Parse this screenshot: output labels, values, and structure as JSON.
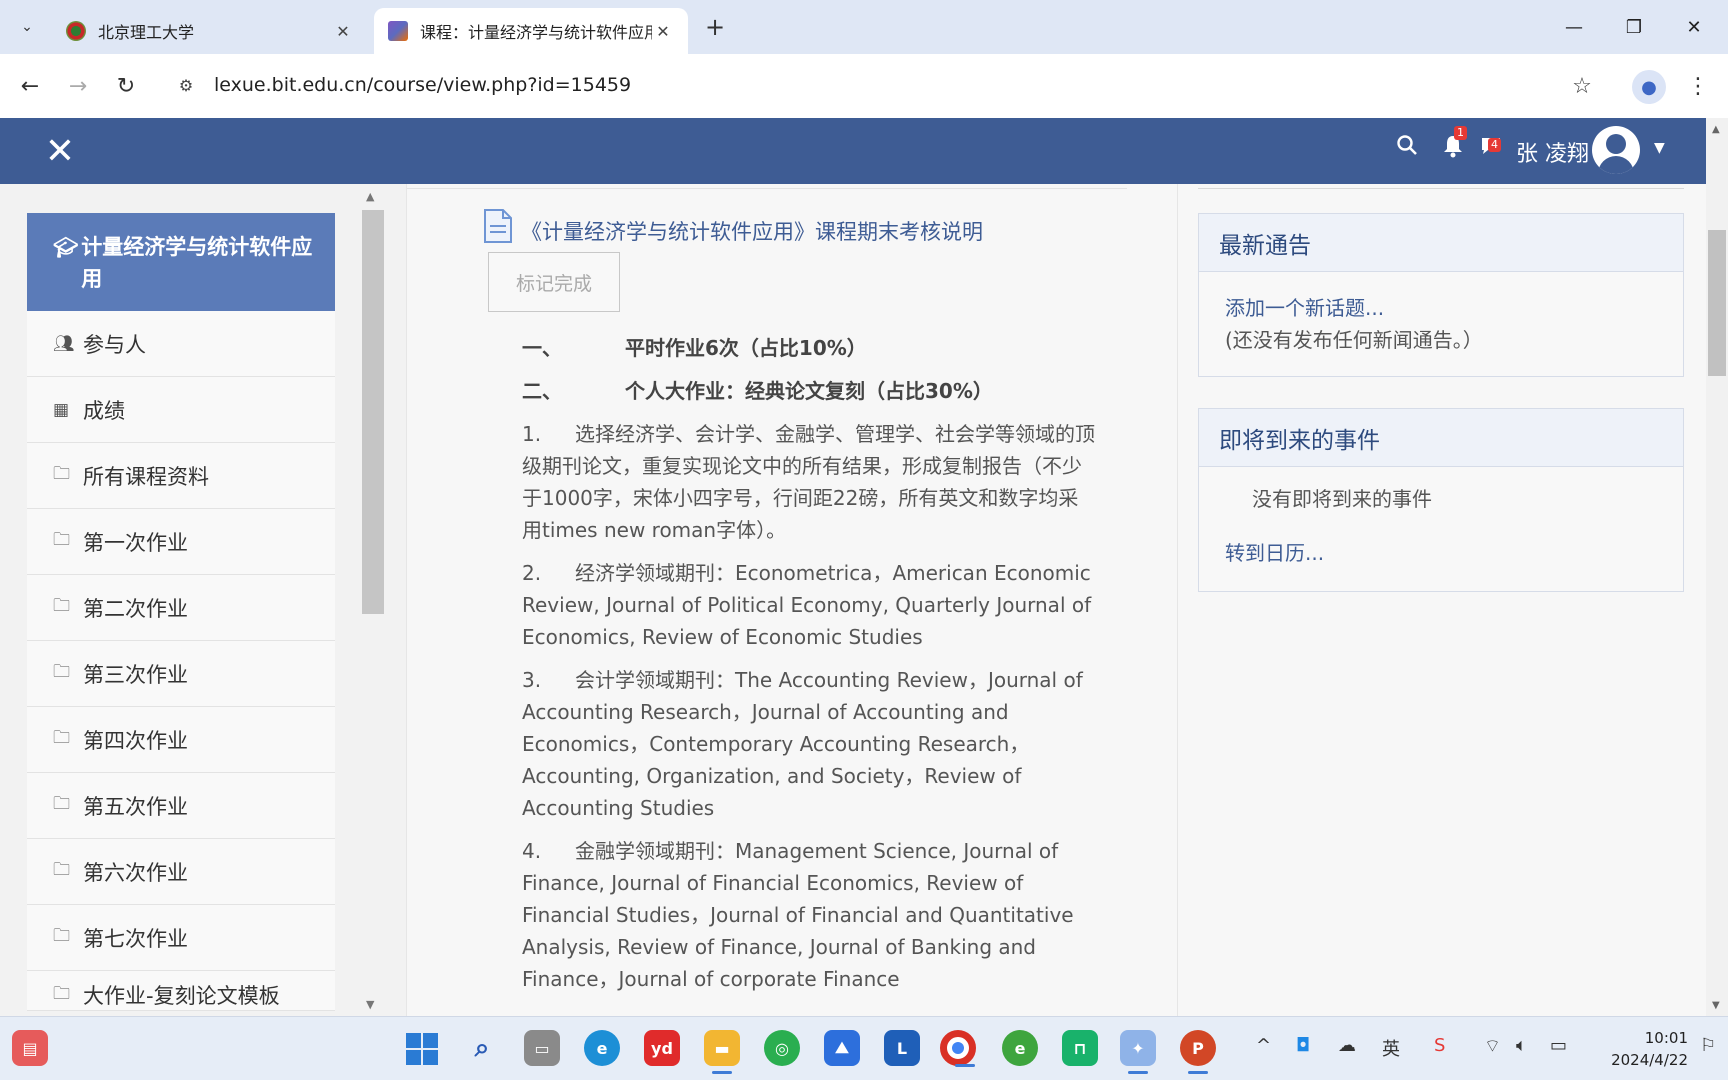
{
  "browser": {
    "tabs": [
      {
        "title": "北京理工大学"
      },
      {
        "title": "课程：计量经济学与统计软件应用"
      }
    ],
    "url": "lexue.bit.edu.cn/course/view.php?id=15459"
  },
  "header": {
    "notification_count": "1",
    "message_count": "4",
    "user_name": "张 凌翔"
  },
  "drawer": {
    "course_name": "计量经济学与统计软件应用",
    "items": [
      {
        "label": "参与人",
        "icon": "users-icon"
      },
      {
        "label": "成绩",
        "icon": "table-icon"
      },
      {
        "label": "所有课程资料",
        "icon": "folder-icon"
      },
      {
        "label": "第一次作业",
        "icon": "folder-icon"
      },
      {
        "label": "第二次作业",
        "icon": "folder-icon"
      },
      {
        "label": "第三次作业",
        "icon": "folder-icon"
      },
      {
        "label": "第四次作业",
        "icon": "folder-icon"
      },
      {
        "label": "第五次作业",
        "icon": "folder-icon"
      },
      {
        "label": "第六次作业",
        "icon": "folder-icon"
      },
      {
        "label": "第七次作业",
        "icon": "folder-icon"
      },
      {
        "label": "大作业-复刻论文模板",
        "icon": "folder-icon"
      }
    ]
  },
  "main": {
    "doc_title": "《计量经济学与统计软件应用》课程期末考核说明",
    "mark_done": "标记完成",
    "headings": [
      {
        "num": "一、",
        "text": "平时作业6次（占比10%）"
      },
      {
        "num": "二、",
        "text": "个人大作业：经典论文复刻（占比30%）"
      }
    ],
    "paragraphs": [
      {
        "num": "1.",
        "text": "选择经济学、会计学、金融学、管理学、社会学等领域的顶级期刊论文，重复实现论文中的所有结果，形成复制报告（不少于1000字，宋体小四字号，行间距22磅，所有英文和数字均采用times new roman字体）。"
      },
      {
        "num": "2.",
        "text": "经济学领域期刊：Econometrica，American Economic Review, Journal of Political Economy, Quarterly Journal of Economics, Review of Economic Studies"
      },
      {
        "num": "3.",
        "text": "会计学领域期刊：The Accounting Review，Journal of Accounting Research，Journal of Accounting and Economics，Contemporary Accounting Research，Accounting, Organization, and Society，Review of Accounting Studies"
      },
      {
        "num": "4.",
        "text": "金融学领域期刊：Management Science, Journal of Finance, Journal of Financial Economics, Review of Financial Studies，Journal of Financial and Quantitative Analysis, Review of Finance, Journal of Banking and Finance，Journal of corporate Finance"
      }
    ]
  },
  "news_block": {
    "title": "最新通告",
    "add_link": "添加一个新话题...",
    "empty_text": "(还没有发布任何新闻通告。）"
  },
  "events_block": {
    "title": "即将到来的事件",
    "empty_text": "没有即将到来的事件",
    "calendar_link": "转到日历..."
  },
  "taskbar": {
    "apps": [
      "widgets-icon",
      "start-icon",
      "search-icon",
      "task-view-icon",
      "edge-icon",
      "youdao-icon",
      "file-explorer-icon",
      "wechat-icon",
      "lark-icon",
      "lenovo-icon",
      "chrome-icon",
      "browser-e-icon",
      "store-icon",
      "app-icon",
      "powerpoint-icon"
    ],
    "ime": "英",
    "time": "10:01",
    "date": "2024/4/22"
  },
  "colors": {
    "header_bg": "#3e5c94",
    "course_active_bg": "#5b7bb8",
    "link": "#3e5c94"
  }
}
